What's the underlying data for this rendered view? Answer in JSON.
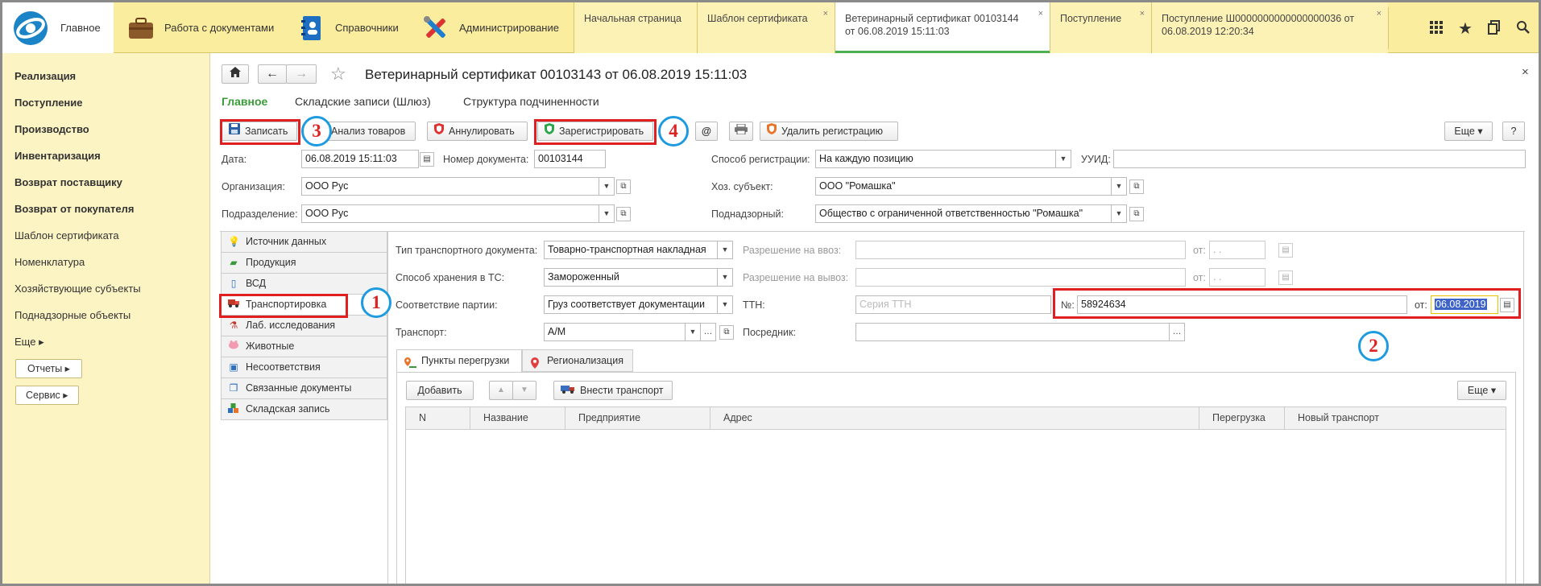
{
  "topbar": {
    "sections": [
      {
        "label": "Главное",
        "icon": "app-logo-icon"
      },
      {
        "label": "Работа с документами",
        "icon": "briefcase-icon"
      },
      {
        "label": "Справочники",
        "icon": "address-book-icon"
      },
      {
        "label": "Администрирование",
        "icon": "tools-icon"
      }
    ],
    "tabs": [
      {
        "line1": "Начальная страница",
        "line2": "",
        "closable": false
      },
      {
        "line1": "Шаблон сертификата",
        "line2": "",
        "closable": true
      },
      {
        "line1": "Ветеринарный сертификат 00103144",
        "line2": "от 06.08.2019 15:11:03",
        "closable": true,
        "active": true
      },
      {
        "line1": "Поступление",
        "line2": "",
        "closable": true
      },
      {
        "line1": "Поступление Ш0000000000000000036 от",
        "line2": "06.08.2019 12:20:34",
        "closable": true
      }
    ],
    "close_glyph": "×",
    "icons": [
      "apps-grid-icon",
      "star-icon",
      "history-icon",
      "search-icon"
    ]
  },
  "sidebar": {
    "items": [
      {
        "label": "Реализация",
        "bold": true
      },
      {
        "label": "Поступление",
        "bold": true
      },
      {
        "label": "Производство",
        "bold": true
      },
      {
        "label": "Инвентаризация",
        "bold": true
      },
      {
        "label": "Возврат поставщику",
        "bold": true
      },
      {
        "label": "Возврат от покупателя",
        "bold": true
      },
      {
        "label": "Шаблон сертификата",
        "bold": false
      },
      {
        "label": "Номенклатура",
        "bold": false
      },
      {
        "label": "Хозяйствующие субъекты",
        "bold": false
      },
      {
        "label": "Поднадзорные объекты",
        "bold": false
      },
      {
        "label": "Еще ▸",
        "bold": false
      }
    ],
    "buttons": [
      "Отчеты ▸",
      "Сервис ▸"
    ]
  },
  "doc": {
    "title": "Ветеринарный сертификат 00103143 от 06.08.2019 15:11:03",
    "close": "×",
    "subtabs": [
      "Главное",
      "Складские записи (Шлюз)",
      "Структура подчиненности"
    ],
    "toolbar": {
      "save": "Записать",
      "analyze": "Анализ товаров",
      "annul": "Аннулировать",
      "register": "Зарегистрировать",
      "email": "@",
      "print": "🖶",
      "delete_reg": "Удалить регистрацию",
      "more": "Еще ▾",
      "help": "?"
    },
    "header_fields": {
      "date_label": "Дата:",
      "date_value": "06.08.2019 15:11:03",
      "docnum_label": "Номер документа:",
      "docnum_value": "00103144",
      "org_label": "Организация:",
      "org_value": "ООО Рус",
      "dept_label": "Подразделение:",
      "dept_value": "ООО Рус",
      "regmode_label": "Способ регистрации:",
      "regmode_value": "На каждую позицию",
      "uuid_label": "УУИД:",
      "uuid_value": "",
      "subject_label": "Хоз. субъект:",
      "subject_value": "ООО \"Ромашка\"",
      "supervised_label": "Поднадзорный:",
      "supervised_value": "Общество с ограниченной ответственностью \"Ромашка\""
    }
  },
  "left_nav": [
    {
      "label": "Источник данных",
      "icon": "lightbulb-icon"
    },
    {
      "label": "Продукция",
      "icon": "basket-icon"
    },
    {
      "label": "ВСД",
      "icon": "document-icon"
    },
    {
      "label": "Транспортировка",
      "icon": "truck-icon"
    },
    {
      "label": "Лаб. исследования",
      "icon": "flask-icon"
    },
    {
      "label": "Животные",
      "icon": "pig-icon"
    },
    {
      "label": "Несоответствия",
      "icon": "clipboard-icon"
    },
    {
      "label": "Связанные документы",
      "icon": "linked-docs-icon"
    },
    {
      "label": "Складская запись",
      "icon": "warehouse-icon"
    }
  ],
  "transport": {
    "doc_type_label": "Тип транспортного документа:",
    "doc_type_value": "Товарно-транспортная накладная",
    "storage_label": "Способ хранения в ТС:",
    "storage_value": "Замороженный",
    "match_label": "Соответствие партии:",
    "match_value": "Груз соответствует документации",
    "vehicle_label": "Транспорт:",
    "vehicle_value": "А/М",
    "import_label": "Разрешение на ввоз:",
    "export_label": "Разрешение на вывоз:",
    "from_label": "от:",
    "date_mask": ". .",
    "ttn_label": "ТТН:",
    "ttn_series_placeholder": "Серия ТТН",
    "ttn_num_label": "№:",
    "ttn_num_value": "58924634",
    "ttn_date_value": "06.08.2019",
    "intermediary_label": "Посредник:",
    "intermediary_value": ""
  },
  "inner_tabs": [
    "Пункты перегрузки",
    "Регионализация"
  ],
  "table_toolbar": {
    "add": "Добавить",
    "up": "▲",
    "down": "▼",
    "add_transport": "Внести транспорт",
    "more": "Еще ▾"
  },
  "table": {
    "columns": [
      "N",
      "Название",
      "Предприятие",
      "Адрес",
      "Перегрузка",
      "Новый транспорт"
    ],
    "rows": []
  },
  "annotations": [
    "1",
    "2",
    "3",
    "4"
  ],
  "colors": {
    "topbar_bg": "#fbed9e",
    "sidebar_bg": "#fdf4c4",
    "accent_green": "#4caf50",
    "highlight_red": "#e02020",
    "marker_blue": "#1e9be0"
  }
}
